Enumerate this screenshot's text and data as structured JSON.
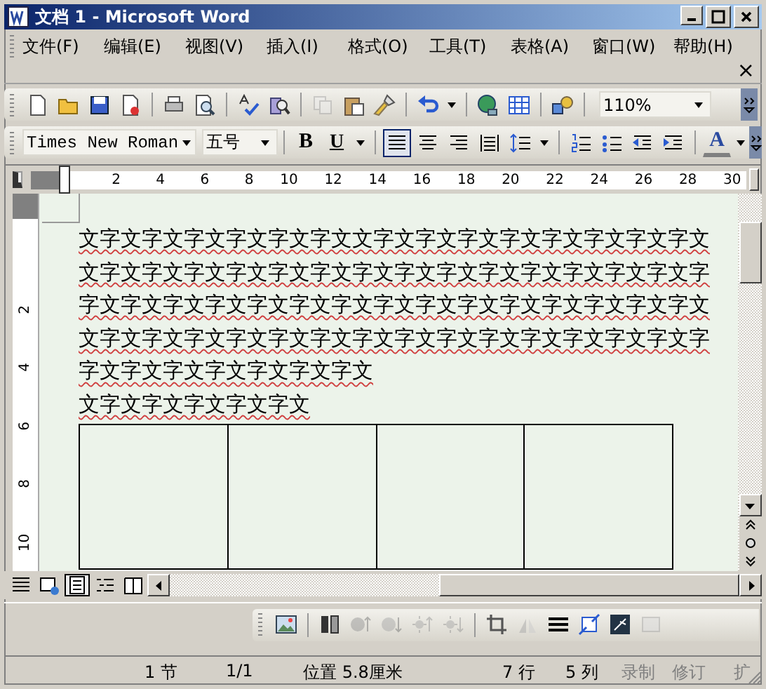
{
  "window": {
    "title": "文档 1 - Microsoft Word"
  },
  "menu": {
    "items": [
      {
        "label": "文件(F)"
      },
      {
        "label": "编辑(E)"
      },
      {
        "label": "视图(V)"
      },
      {
        "label": "插入(I)"
      },
      {
        "label": "格式(O)"
      },
      {
        "label": "工具(T)"
      },
      {
        "label": "表格(A)"
      },
      {
        "label": "窗口(W)"
      },
      {
        "label": "帮助(H)"
      }
    ],
    "close_glyph": "×"
  },
  "standard_toolbar": {
    "buttons": [
      {
        "kind": "new",
        "disabled": false
      },
      {
        "kind": "open",
        "disabled": false
      },
      {
        "kind": "save",
        "disabled": false
      },
      {
        "kind": "permission",
        "disabled": false
      },
      {
        "kind": "sep"
      },
      {
        "kind": "print",
        "disabled": false
      },
      {
        "kind": "preview",
        "disabled": false
      },
      {
        "kind": "sep"
      },
      {
        "kind": "spelling",
        "disabled": false
      },
      {
        "kind": "research",
        "disabled": false
      },
      {
        "kind": "sep"
      },
      {
        "kind": "copy",
        "disabled": true
      },
      {
        "kind": "paste",
        "disabled": false
      },
      {
        "kind": "brush",
        "disabled": false
      },
      {
        "kind": "sep"
      },
      {
        "kind": "undo",
        "disabled": false
      },
      {
        "kind": "drop"
      },
      {
        "kind": "sep"
      },
      {
        "kind": "hyperlink",
        "disabled": false
      },
      {
        "kind": "table",
        "disabled": false
      },
      {
        "kind": "sep"
      },
      {
        "kind": "drawing",
        "disabled": false
      },
      {
        "kind": "sep"
      }
    ],
    "zoom": "110%"
  },
  "formatting_toolbar": {
    "font": "Times New Roman",
    "size": "五号",
    "buttons": [
      {
        "kind": "bold",
        "label": "B",
        "selected": false
      },
      {
        "kind": "underline",
        "label": "U",
        "selected": false
      },
      {
        "kind": "drop"
      },
      {
        "kind": "sep"
      },
      {
        "kind": "justify",
        "selected": true
      },
      {
        "kind": "center",
        "selected": false
      },
      {
        "kind": "right",
        "selected": false
      },
      {
        "kind": "distribute",
        "selected": false
      },
      {
        "kind": "spacing",
        "selected": false
      },
      {
        "kind": "drop"
      },
      {
        "kind": "sep"
      },
      {
        "kind": "numbering",
        "selected": false
      },
      {
        "kind": "bullets",
        "selected": false
      },
      {
        "kind": "outdent",
        "selected": false
      },
      {
        "kind": "indent",
        "selected": false
      },
      {
        "kind": "sep"
      },
      {
        "kind": "fontcolor",
        "label": "A",
        "selected": false
      },
      {
        "kind": "drop"
      }
    ]
  },
  "ruler": {
    "labels": [
      "2",
      "4",
      "6",
      "8",
      "10",
      "12",
      "14",
      "16",
      "18",
      "20",
      "22",
      "24",
      "26",
      "28",
      "30"
    ]
  },
  "vertical_ruler": {
    "labels": [
      "2",
      "4",
      "6",
      "8",
      "10"
    ]
  },
  "document": {
    "paragraphs": [
      {
        "text": "文字文字文字文字文字文字文文字文字文字文字文字文字文字文字文",
        "spelling_error": true
      },
      {
        "text": "文字文字文字文字文字文字文字文字文字文字文字文字文字文字文字",
        "spelling_error": true
      },
      {
        "text": "字文字文字文字文字文字文字文字文字文字文字文字文字文字文字文",
        "spelling_error": true
      },
      {
        "text": "文字文字文字文字文字文字文字文字文字文字文字文字文字文字文字",
        "spelling_error": true
      },
      {
        "text": "字文字文字文字文字文字文字文",
        "spelling_error": true
      },
      {
        "text": "文字文字文字文字文字文",
        "spelling_error": true
      }
    ],
    "table": {
      "rows": [
        {
          "cells": [
            {
              "kind": "empty"
            },
            {
              "kind": "empty"
            },
            {
              "kind": "empty"
            },
            {
              "kind": "empty"
            }
          ]
        }
      ]
    }
  },
  "view_buttons": [
    {
      "kind": "normal",
      "selected": false
    },
    {
      "kind": "web",
      "selected": false
    },
    {
      "kind": "print",
      "selected": true
    },
    {
      "kind": "outline",
      "selected": false
    },
    {
      "kind": "reading",
      "selected": false
    }
  ],
  "picture_toolbar": {
    "buttons": [
      {
        "kind": "insert-picture",
        "disabled": false
      },
      {
        "kind": "sep"
      },
      {
        "kind": "color",
        "disabled": false
      },
      {
        "kind": "more-contrast",
        "disabled": true
      },
      {
        "kind": "less-contrast",
        "disabled": true
      },
      {
        "kind": "more-bright",
        "disabled": true
      },
      {
        "kind": "less-bright",
        "disabled": true
      },
      {
        "kind": "sep"
      },
      {
        "kind": "crop",
        "disabled": false
      },
      {
        "kind": "rotate",
        "disabled": true
      },
      {
        "kind": "line-style",
        "disabled": false
      },
      {
        "kind": "compress",
        "disabled": false
      },
      {
        "kind": "wrap",
        "disabled": false
      },
      {
        "kind": "format",
        "disabled": true
      }
    ]
  },
  "status_bar": {
    "items": [
      {
        "text": "1 节",
        "disabled": false
      },
      {
        "text": "1/1",
        "disabled": false
      },
      {
        "text": "位置 5.8厘米",
        "disabled": false
      },
      {
        "text": "7 行",
        "disabled": false
      },
      {
        "text": "5 列",
        "disabled": false
      },
      {
        "text": "录制",
        "disabled": true
      },
      {
        "text": "修订",
        "disabled": true
      },
      {
        "text": "扩",
        "disabled": true
      }
    ]
  }
}
